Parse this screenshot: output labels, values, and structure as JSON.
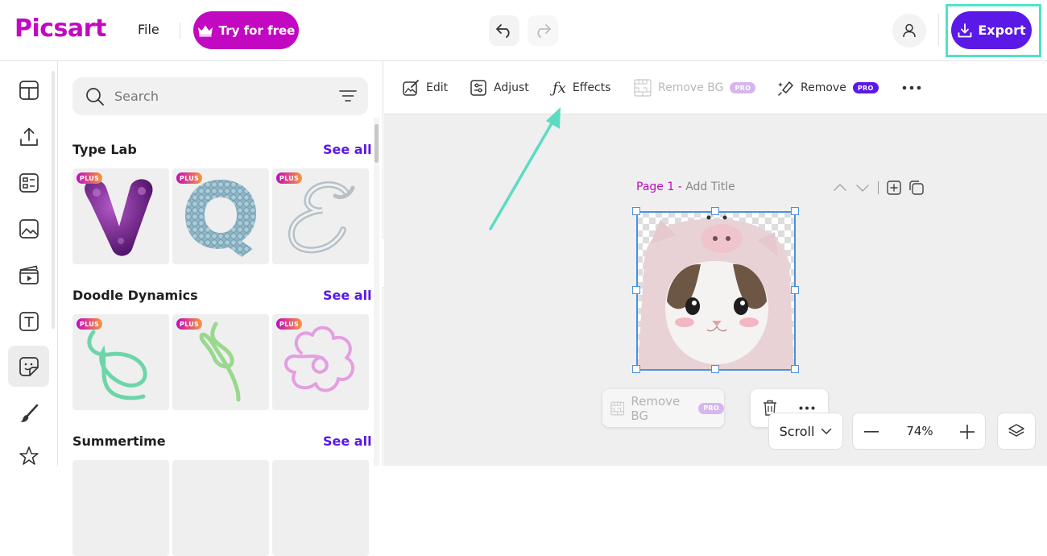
{
  "header": {
    "logo_text": "Picsart",
    "file_label": "File",
    "try_label": "Try for free",
    "export_label": "Export"
  },
  "panel": {
    "search": {
      "placeholder": "Search"
    },
    "sections": [
      {
        "title": "Type Lab",
        "see_all": "See all",
        "badges": [
          "PLUS",
          "PLUS",
          "PLUS"
        ]
      },
      {
        "title": "Doodle Dynamics",
        "see_all": "See all",
        "badges": [
          "PLUS",
          "PLUS",
          "PLUS"
        ]
      },
      {
        "title": "Summertime",
        "see_all": "See all"
      }
    ]
  },
  "toolbar": {
    "edit": "Edit",
    "adjust": "Adjust",
    "effects": "Effects",
    "remove_bg": "Remove BG",
    "remove_bg_badge": "PRO",
    "remove": "Remove",
    "remove_badge": "PRO"
  },
  "canvas": {
    "page_label": "Page 1 -",
    "page_title": "Add Title",
    "float_remove_bg": "Remove BG",
    "float_badge": "PRO",
    "scroll_label": "Scroll",
    "zoom_value": "74%"
  },
  "colors": {
    "brand": "#c209c1",
    "accent": "#5a19e7",
    "highlight": "#4fe3c9",
    "selection": "#4a90e2"
  }
}
